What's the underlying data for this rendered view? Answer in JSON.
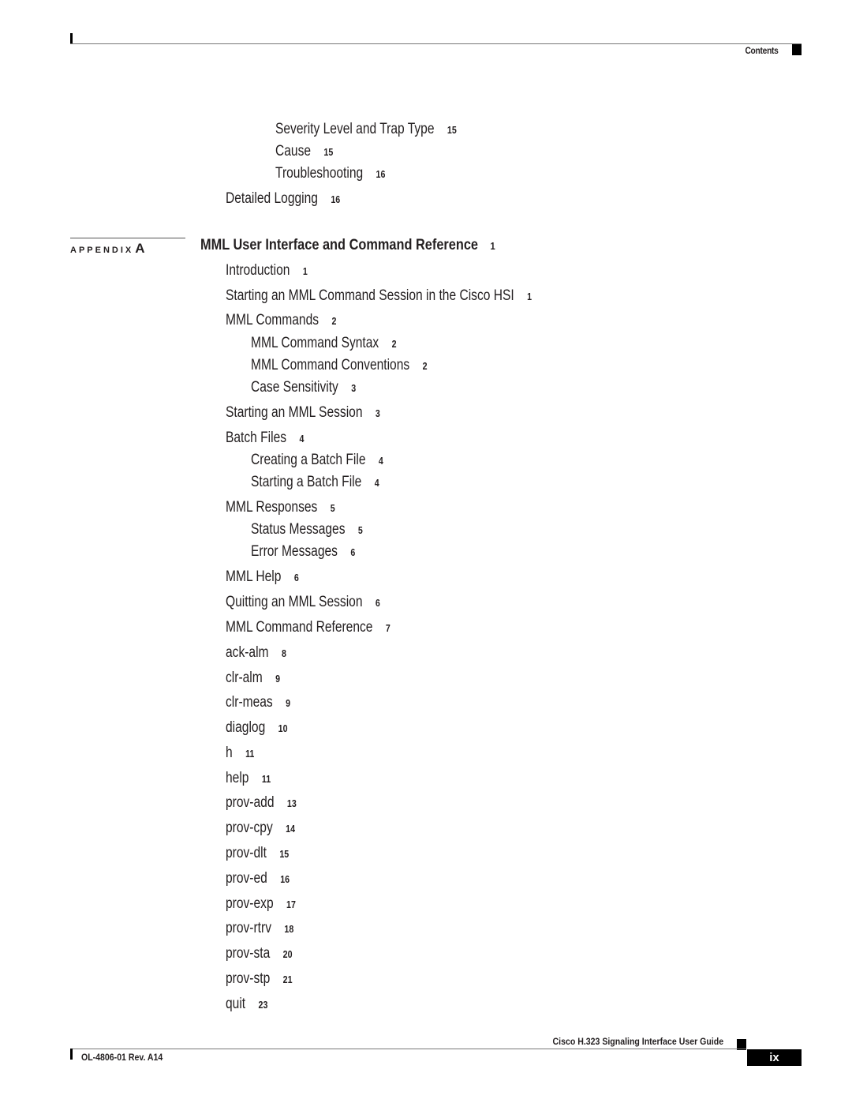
{
  "header": {
    "section_label": "Contents"
  },
  "continued_entries": [
    {
      "title": "Severity Level and Trap Type",
      "page": "15",
      "level": 3
    },
    {
      "title": "Cause",
      "page": "15",
      "level": 3
    },
    {
      "title": "Troubleshooting",
      "page": "16",
      "level": 3
    },
    {
      "title": "Detailed Logging",
      "page": "16",
      "level": 1
    }
  ],
  "appendix": {
    "label": "APPENDIX",
    "letter": "A",
    "title": "MML User Interface and Command Reference",
    "page": "1"
  },
  "entries": [
    {
      "title": "Introduction",
      "page": "1",
      "level": 1
    },
    {
      "title": "Starting an MML Command Session in the Cisco HSI",
      "page": "1",
      "level": 1
    },
    {
      "title": "MML Commands",
      "page": "2",
      "level": 1
    },
    {
      "title": "MML Command Syntax",
      "page": "2",
      "level": 2
    },
    {
      "title": "MML Command Conventions",
      "page": "2",
      "level": 2
    },
    {
      "title": "Case Sensitivity",
      "page": "3",
      "level": 2
    },
    {
      "title": "Starting an MML Session",
      "page": "3",
      "level": 1
    },
    {
      "title": "Batch Files",
      "page": "4",
      "level": 1
    },
    {
      "title": "Creating a Batch File",
      "page": "4",
      "level": 2
    },
    {
      "title": "Starting a Batch File",
      "page": "4",
      "level": 2
    },
    {
      "title": "MML Responses",
      "page": "5",
      "level": 1
    },
    {
      "title": "Status Messages",
      "page": "5",
      "level": 2
    },
    {
      "title": "Error Messages",
      "page": "6",
      "level": 2
    },
    {
      "title": "MML Help",
      "page": "6",
      "level": 1
    },
    {
      "title": "Quitting an MML Session",
      "page": "6",
      "level": 1
    },
    {
      "title": "MML Command Reference",
      "page": "7",
      "level": 1
    },
    {
      "title": "ack-alm",
      "page": "8",
      "level": 1
    },
    {
      "title": "clr-alm",
      "page": "9",
      "level": 1
    },
    {
      "title": "clr-meas",
      "page": "9",
      "level": 1
    },
    {
      "title": "diaglog",
      "page": "10",
      "level": 1
    },
    {
      "title": "h",
      "page": "11",
      "level": 1
    },
    {
      "title": "help",
      "page": "11",
      "level": 1
    },
    {
      "title": "prov-add",
      "page": "13",
      "level": 1
    },
    {
      "title": "prov-cpy",
      "page": "14",
      "level": 1
    },
    {
      "title": "prov-dlt",
      "page": "15",
      "level": 1
    },
    {
      "title": "prov-ed",
      "page": "16",
      "level": 1
    },
    {
      "title": "prov-exp",
      "page": "17",
      "level": 1
    },
    {
      "title": "prov-rtrv",
      "page": "18",
      "level": 1
    },
    {
      "title": "prov-sta",
      "page": "20",
      "level": 1
    },
    {
      "title": "prov-stp",
      "page": "21",
      "level": 1
    },
    {
      "title": "quit",
      "page": "23",
      "level": 1
    }
  ],
  "footer": {
    "guide_title": "Cisco H.323 Signaling Interface User Guide",
    "doc_number": "OL-4806-01 Rev. A14",
    "page_number": "ix"
  }
}
